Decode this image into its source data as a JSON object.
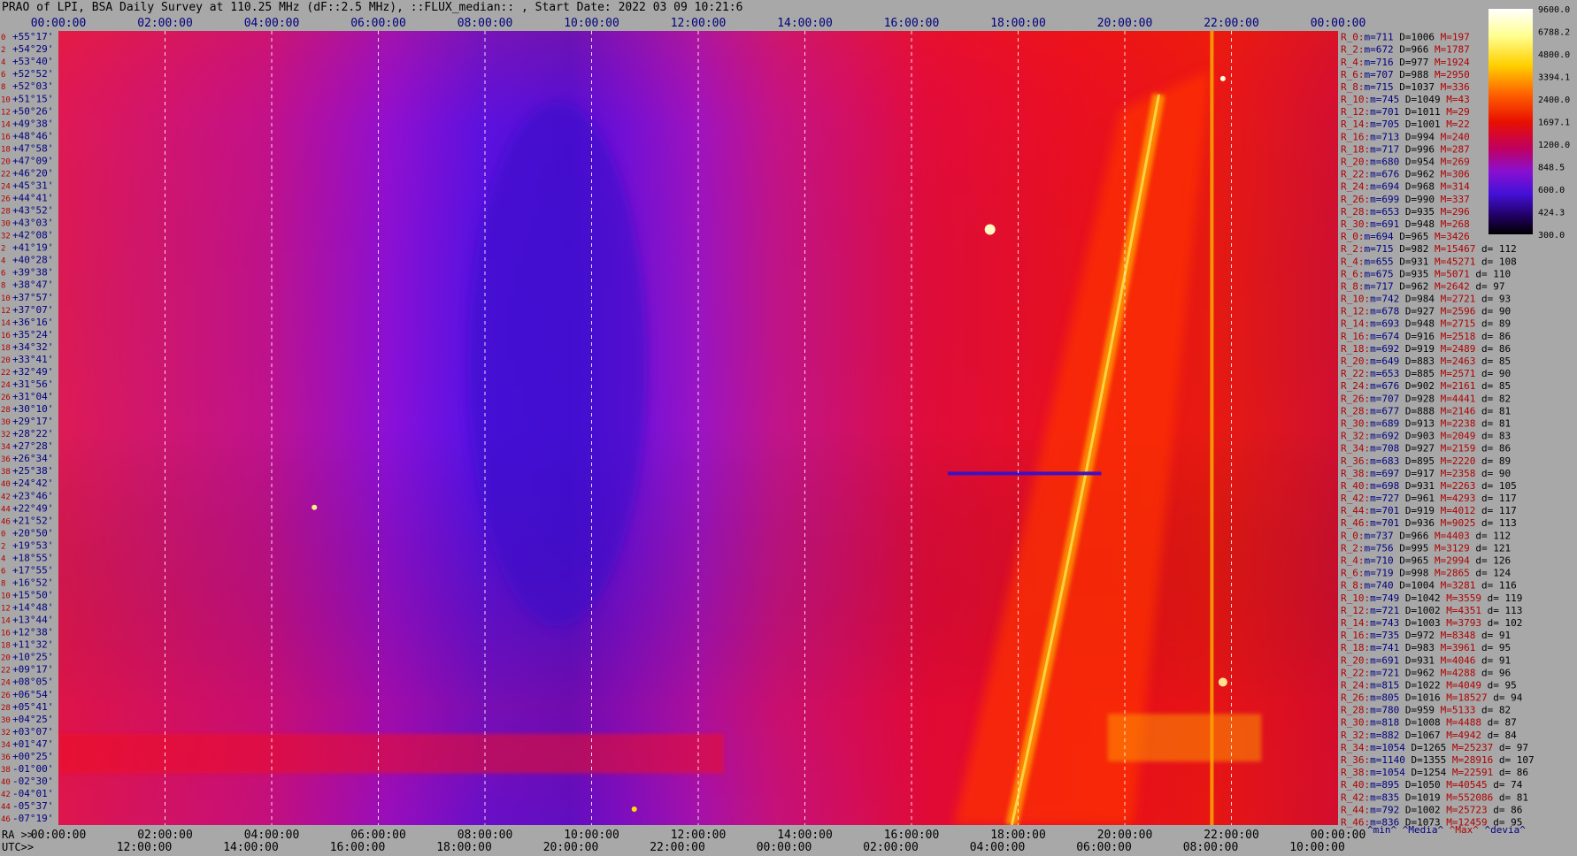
{
  "title": "PRAO of LPI, BSA Daily Survey at 110.25 MHz (dF::2.5 MHz), ::FLUX_median:: , Start Date: 2022 03 09 10:21:6",
  "colors": {
    "background": "#a8a8a8",
    "label_red": "#b00000",
    "label_blue": "#000080",
    "label_black": "#000000"
  },
  "chart_data": {
    "type": "heatmap",
    "title": "PRAO of LPI, BSA Daily Survey at 110.25 MHz (dF::2.5 MHz), ::FLUX_median:: , Start Date: 2022 03 09 10:21:6",
    "frequency_mhz": 110.25,
    "bandwidth_mhz": 2.5,
    "start_date": "2022 03 09 10:21:6",
    "x_top_ticks": [
      "00:00:00",
      "02:00:00",
      "04:00:00",
      "06:00:00",
      "08:00:00",
      "10:00:00",
      "12:00:00",
      "14:00:00",
      "16:00:00",
      "18:00:00",
      "20:00:00",
      "22:00:00",
      "00:00:00"
    ],
    "x_bottom_ra_label": "RA >>",
    "x_bottom_ra_ticks": [
      "00:00:00",
      "02:00:00",
      "04:00:00",
      "06:00:00",
      "08:00:00",
      "10:00:00",
      "12:00:00",
      "14:00:00",
      "16:00:00",
      "18:00:00",
      "20:00:00",
      "22:00:00",
      "00:00:00"
    ],
    "x_bottom_utc_label": "UTC>>",
    "x_bottom_utc_ticks": [
      "12:00:00",
      "14:00:00",
      "16:00:00",
      "18:00:00",
      "20:00:00",
      "22:00:00",
      "00:00:00",
      "02:00:00",
      "04:00:00",
      "06:00:00",
      "08:00:00",
      "10:00:00"
    ],
    "y_rows": [
      {
        "idx": "0",
        "dec": "+55°17'"
      },
      {
        "idx": "2",
        "dec": "+54°29'"
      },
      {
        "idx": "4",
        "dec": "+53°40'"
      },
      {
        "idx": "6",
        "dec": "+52°52'"
      },
      {
        "idx": "8",
        "dec": "+52°03'"
      },
      {
        "idx": "10",
        "dec": "+51°15'"
      },
      {
        "idx": "12",
        "dec": "+50°26'"
      },
      {
        "idx": "14",
        "dec": "+49°38'"
      },
      {
        "idx": "16",
        "dec": "+48°46'"
      },
      {
        "idx": "18",
        "dec": "+47°58'"
      },
      {
        "idx": "20",
        "dec": "+47°09'"
      },
      {
        "idx": "22",
        "dec": "+46°20'"
      },
      {
        "idx": "24",
        "dec": "+45°31'"
      },
      {
        "idx": "26",
        "dec": "+44°41'"
      },
      {
        "idx": "28",
        "dec": "+43°52'"
      },
      {
        "idx": "30",
        "dec": "+43°03'"
      },
      {
        "idx": "32",
        "dec": "+42°08'"
      },
      {
        "idx": "2",
        "dec": "+41°19'"
      },
      {
        "idx": "4",
        "dec": "+40°28'"
      },
      {
        "idx": "6",
        "dec": "+39°38'"
      },
      {
        "idx": "8",
        "dec": "+38°47'"
      },
      {
        "idx": "10",
        "dec": "+37°57'"
      },
      {
        "idx": "12",
        "dec": "+37°07'"
      },
      {
        "idx": "14",
        "dec": "+36°16'"
      },
      {
        "idx": "16",
        "dec": "+35°24'"
      },
      {
        "idx": "18",
        "dec": "+34°32'"
      },
      {
        "idx": "20",
        "dec": "+33°41'"
      },
      {
        "idx": "22",
        "dec": "+32°49'"
      },
      {
        "idx": "24",
        "dec": "+31°56'"
      },
      {
        "idx": "26",
        "dec": "+31°04'"
      },
      {
        "idx": "28",
        "dec": "+30°10'"
      },
      {
        "idx": "30",
        "dec": "+29°17'"
      },
      {
        "idx": "32",
        "dec": "+28°22'"
      },
      {
        "idx": "34",
        "dec": "+27°28'"
      },
      {
        "idx": "36",
        "dec": "+26°34'"
      },
      {
        "idx": "38",
        "dec": "+25°38'"
      },
      {
        "idx": "40",
        "dec": "+24°42'"
      },
      {
        "idx": "42",
        "dec": "+23°46'"
      },
      {
        "idx": "44",
        "dec": "+22°49'"
      },
      {
        "idx": "46",
        "dec": "+21°52'"
      },
      {
        "idx": "0",
        "dec": "+20°50'"
      },
      {
        "idx": "2",
        "dec": "+19°53'"
      },
      {
        "idx": "4",
        "dec": "+18°55'"
      },
      {
        "idx": "6",
        "dec": "+17°55'"
      },
      {
        "idx": "8",
        "dec": "+16°52'"
      },
      {
        "idx": "10",
        "dec": "+15°50'"
      },
      {
        "idx": "12",
        "dec": "+14°48'"
      },
      {
        "idx": "14",
        "dec": "+13°44'"
      },
      {
        "idx": "16",
        "dec": "+12°38'"
      },
      {
        "idx": "18",
        "dec": "+11°32'"
      },
      {
        "idx": "20",
        "dec": "+10°25'"
      },
      {
        "idx": "22",
        "dec": "+09°17'"
      },
      {
        "idx": "24",
        "dec": "+08°05'"
      },
      {
        "idx": "26",
        "dec": "+06°54'"
      },
      {
        "idx": "28",
        "dec": "+05°41'"
      },
      {
        "idx": "30",
        "dec": "+04°25'"
      },
      {
        "idx": "32",
        "dec": "+03°07'"
      },
      {
        "idx": "34",
        "dec": "+01°47'"
      },
      {
        "idx": "36",
        "dec": "+00°25'"
      },
      {
        "idx": "38",
        "dec": "-01°00'"
      },
      {
        "idx": "40",
        "dec": "-02°30'"
      },
      {
        "idx": "42",
        "dec": "-04°01'"
      },
      {
        "idx": "44",
        "dec": "-05°37'"
      },
      {
        "idx": "46",
        "dec": "-07°19'"
      }
    ],
    "colorbar_ticks": [
      "9600.0",
      "6788.2",
      "4800.0",
      "3394.1",
      "2400.0",
      "1697.1",
      "1200.0",
      "848.5",
      "600.0",
      "424.3",
      "300.0"
    ],
    "colorbar_scale": "log",
    "colorbar_range": [
      300.0,
      9600.0
    ],
    "stats": [
      {
        "r": "R_0:",
        "m": "711",
        "d": "1006",
        "M": "197",
        "dd": ""
      },
      {
        "r": "R_2:",
        "m": "672",
        "d": "966",
        "M": "1787",
        "dd": ""
      },
      {
        "r": "R_4:",
        "m": "716",
        "d": "977",
        "M": "1924",
        "dd": ""
      },
      {
        "r": "R_6:",
        "m": "707",
        "d": "988",
        "M": "2950",
        "dd": ""
      },
      {
        "r": "R_8:",
        "m": "715",
        "d": "1037",
        "M": "336",
        "dd": ""
      },
      {
        "r": "R_10:",
        "m": "745",
        "d": "1049",
        "M": "43",
        "dd": ""
      },
      {
        "r": "R_12:",
        "m": "701",
        "d": "1011",
        "M": "29",
        "dd": ""
      },
      {
        "r": "R_14:",
        "m": "705",
        "d": "1001",
        "M": "22",
        "dd": ""
      },
      {
        "r": "R_16:",
        "m": "713",
        "d": "994",
        "M": "240",
        "dd": ""
      },
      {
        "r": "R_18:",
        "m": "717",
        "d": "996",
        "M": "287",
        "dd": ""
      },
      {
        "r": "R_20:",
        "m": "680",
        "d": "954",
        "M": "269",
        "dd": ""
      },
      {
        "r": "R_22:",
        "m": "676",
        "d": "962",
        "M": "306",
        "dd": ""
      },
      {
        "r": "R_24:",
        "m": "694",
        "d": "968",
        "M": "314",
        "dd": ""
      },
      {
        "r": "R_26:",
        "m": "699",
        "d": "990",
        "M": "337",
        "dd": ""
      },
      {
        "r": "R_28:",
        "m": "653",
        "d": "935",
        "M": "296",
        "dd": ""
      },
      {
        "r": "R_30:",
        "m": "691",
        "d": "948",
        "M": "268",
        "dd": ""
      },
      {
        "r": "R_0:",
        "m": "694",
        "d": "965",
        "M": "3426",
        "dd": ""
      },
      {
        "r": "R_2:",
        "m": "715",
        "d": "982",
        "M": "15467",
        "dd": "112"
      },
      {
        "r": "R_4:",
        "m": "655",
        "d": "931",
        "M": "45271",
        "dd": "108"
      },
      {
        "r": "R_6:",
        "m": "675",
        "d": "935",
        "M": "5071",
        "dd": "110"
      },
      {
        "r": "R_8:",
        "m": "717",
        "d": "962",
        "M": "2642",
        "dd": "97"
      },
      {
        "r": "R_10:",
        "m": "742",
        "d": "984",
        "M": "2721",
        "dd": "93"
      },
      {
        "r": "R_12:",
        "m": "678",
        "d": "927",
        "M": "2596",
        "dd": "90"
      },
      {
        "r": "R_14:",
        "m": "693",
        "d": "948",
        "M": "2715",
        "dd": "89"
      },
      {
        "r": "R_16:",
        "m": "674",
        "d": "916",
        "M": "2518",
        "dd": "86"
      },
      {
        "r": "R_18:",
        "m": "692",
        "d": "919",
        "M": "2489",
        "dd": "86"
      },
      {
        "r": "R_20:",
        "m": "649",
        "d": "883",
        "M": "2463",
        "dd": "85"
      },
      {
        "r": "R_22:",
        "m": "653",
        "d": "885",
        "M": "2571",
        "dd": "90"
      },
      {
        "r": "R_24:",
        "m": "676",
        "d": "902",
        "M": "2161",
        "dd": "85"
      },
      {
        "r": "R_26:",
        "m": "707",
        "d": "928",
        "M": "4441",
        "dd": "82"
      },
      {
        "r": "R_28:",
        "m": "677",
        "d": "888",
        "M": "2146",
        "dd": "81"
      },
      {
        "r": "R_30:",
        "m": "689",
        "d": "913",
        "M": "2238",
        "dd": "81"
      },
      {
        "r": "R_32:",
        "m": "692",
        "d": "903",
        "M": "2049",
        "dd": "83"
      },
      {
        "r": "R_34:",
        "m": "708",
        "d": "927",
        "M": "2159",
        "dd": "86"
      },
      {
        "r": "R_36:",
        "m": "683",
        "d": "895",
        "M": "2220",
        "dd": "89"
      },
      {
        "r": "R_38:",
        "m": "697",
        "d": "917",
        "M": "2358",
        "dd": "90"
      },
      {
        "r": "R_40:",
        "m": "698",
        "d": "931",
        "M": "2263",
        "dd": "105"
      },
      {
        "r": "R_42:",
        "m": "727",
        "d": "961",
        "M": "4293",
        "dd": "117"
      },
      {
        "r": "R_44:",
        "m": "701",
        "d": "919",
        "M": "4012",
        "dd": "117"
      },
      {
        "r": "R_46:",
        "m": "701",
        "d": "936",
        "M": "9025",
        "dd": "113"
      },
      {
        "r": "R_0:",
        "m": "737",
        "d": "966",
        "M": "4403",
        "dd": "112"
      },
      {
        "r": "R_2:",
        "m": "756",
        "d": "995",
        "M": "3129",
        "dd": "121"
      },
      {
        "r": "R_4:",
        "m": "710",
        "d": "965",
        "M": "2994",
        "dd": "126"
      },
      {
        "r": "R_6:",
        "m": "719",
        "d": "998",
        "M": "2865",
        "dd": "124"
      },
      {
        "r": "R_8:",
        "m": "740",
        "d": "1004",
        "M": "3281",
        "dd": "116"
      },
      {
        "r": "R_10:",
        "m": "749",
        "d": "1042",
        "M": "3559",
        "dd": "119"
      },
      {
        "r": "R_12:",
        "m": "721",
        "d": "1002",
        "M": "4351",
        "dd": "113"
      },
      {
        "r": "R_14:",
        "m": "743",
        "d": "1003",
        "M": "3793",
        "dd": "102"
      },
      {
        "r": "R_16:",
        "m": "735",
        "d": "972",
        "M": "8348",
        "dd": "91"
      },
      {
        "r": "R_18:",
        "m": "741",
        "d": "983",
        "M": "3961",
        "dd": "95"
      },
      {
        "r": "R_20:",
        "m": "691",
        "d": "931",
        "M": "4046",
        "dd": "91"
      },
      {
        "r": "R_22:",
        "m": "721",
        "d": "962",
        "M": "4288",
        "dd": "96"
      },
      {
        "r": "R_24:",
        "m": "815",
        "d": "1022",
        "M": "4049",
        "dd": "95"
      },
      {
        "r": "R_26:",
        "m": "805",
        "d": "1016",
        "M": "18527",
        "dd": "94"
      },
      {
        "r": "R_28:",
        "m": "780",
        "d": "959",
        "M": "5133",
        "dd": "82"
      },
      {
        "r": "R_30:",
        "m": "818",
        "d": "1008",
        "M": "4488",
        "dd": "87"
      },
      {
        "r": "R_32:",
        "m": "882",
        "d": "1067",
        "M": "4942",
        "dd": "84"
      },
      {
        "r": "R_34:",
        "m": "1054",
        "d": "1265",
        "M": "25237",
        "dd": "97"
      },
      {
        "r": "R_36:",
        "m": "1140",
        "d": "1355",
        "M": "28916",
        "dd": "107"
      },
      {
        "r": "R_38:",
        "m": "1054",
        "d": "1254",
        "M": "22591",
        "dd": "86"
      },
      {
        "r": "R_40:",
        "m": "895",
        "d": "1050",
        "M": "40545",
        "dd": "74"
      },
      {
        "r": "R_42:",
        "m": "835",
        "d": "1019",
        "M": "552086",
        "dd": "81"
      },
      {
        "r": "R_44:",
        "m": "792",
        "d": "1002",
        "M": "25723",
        "dd": "86"
      },
      {
        "r": "R_46:",
        "m": "836",
        "d": "1073",
        "M": "12459",
        "dd": "95"
      }
    ],
    "stats_legend": [
      "^min^",
      "^Media^",
      "^Max^",
      "^devia^"
    ]
  }
}
